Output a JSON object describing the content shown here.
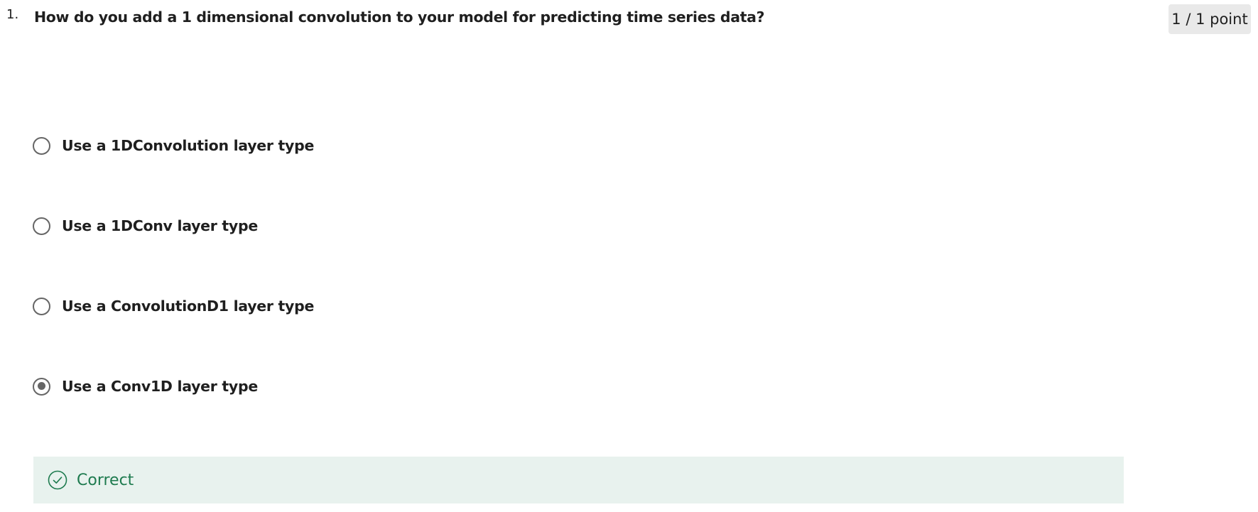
{
  "question": {
    "number": "1.",
    "text": "How do you add a 1 dimensional convolution to your model for predicting time series data?",
    "points": "1 / 1 point"
  },
  "options": [
    {
      "label": "Use a 1DConvolution layer type",
      "selected": false
    },
    {
      "label": "Use a 1DConv layer type",
      "selected": false
    },
    {
      "label": "Use a ConvolutionD1 layer type",
      "selected": false
    },
    {
      "label": "Use a Conv1D layer type",
      "selected": true
    }
  ],
  "feedback": {
    "status": "Correct",
    "icon": "check-circle-icon",
    "color": "#1e7b4f",
    "background": "#e8f2ee"
  },
  "colors": {
    "radio_border": "#666666",
    "text": "#1f1f1f",
    "badge_background": "#e9e9e9"
  }
}
